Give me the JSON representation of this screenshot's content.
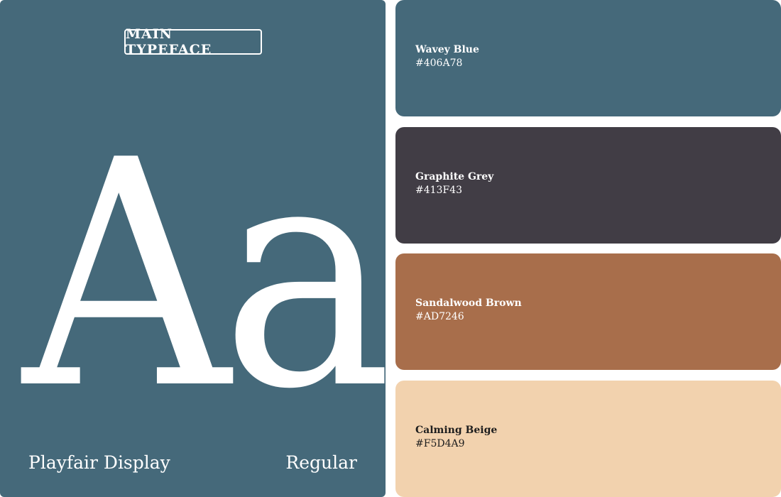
{
  "typeface": {
    "badge": "MAIN TYPEFACE",
    "specimen": "Aa",
    "font_name": "Playfair Display",
    "font_style": "Regular",
    "background": "#406A78"
  },
  "palette": [
    {
      "name": "Wavey Blue",
      "hex": "#406A78",
      "color": "#45697A"
    },
    {
      "name": "Graphite Grey",
      "hex": "#413F43",
      "color": "#413D45"
    },
    {
      "name": "Sandalwood Brown",
      "hex": "#AD7246",
      "color": "#A86E4B"
    },
    {
      "name": "Calming Beige",
      "hex": "#F5D4A9",
      "color": "#F2D2AE"
    }
  ]
}
